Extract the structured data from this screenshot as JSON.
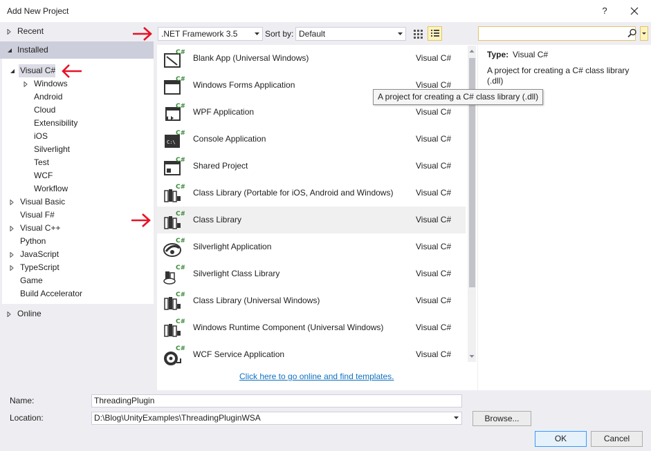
{
  "window": {
    "title": "Add New Project",
    "help_label": "?"
  },
  "tree": {
    "recent": "Recent",
    "installed": "Installed",
    "online": "Online",
    "items": [
      {
        "label": "Visual C#",
        "arrow": "expanded",
        "selected": true
      },
      {
        "label": "Windows",
        "arrow": "collapsed"
      },
      {
        "label": "Android"
      },
      {
        "label": "Cloud"
      },
      {
        "label": "Extensibility"
      },
      {
        "label": "iOS"
      },
      {
        "label": "Silverlight"
      },
      {
        "label": "Test"
      },
      {
        "label": "WCF"
      },
      {
        "label": "Workflow"
      },
      {
        "label": "Visual Basic",
        "arrow": "collapsed"
      },
      {
        "label": "Visual F#"
      },
      {
        "label": "Visual C++",
        "arrow": "collapsed"
      },
      {
        "label": "Python"
      },
      {
        "label": "JavaScript",
        "arrow": "collapsed"
      },
      {
        "label": "TypeScript",
        "arrow": "collapsed"
      },
      {
        "label": "Game"
      },
      {
        "label": "Build Accelerator"
      }
    ]
  },
  "toolbar": {
    "framework": ".NET Framework 3.5",
    "sort_label": "Sort by:",
    "sort_value": "Default",
    "search_placeholder": ""
  },
  "templates": [
    {
      "name": "Blank App (Universal Windows)",
      "lang": "Visual C#",
      "icon": "blank-app-icon"
    },
    {
      "name": "Windows Forms Application",
      "lang": "Visual C#",
      "icon": "windows-forms-icon"
    },
    {
      "name": "WPF Application",
      "lang": "Visual C#",
      "icon": "wpf-icon"
    },
    {
      "name": "Console Application",
      "lang": "Visual C#",
      "icon": "console-icon"
    },
    {
      "name": "Shared Project",
      "lang": "Visual C#",
      "icon": "shared-project-icon"
    },
    {
      "name": "Class Library (Portable for iOS, Android and Windows)",
      "lang": "Visual C#",
      "icon": "class-library-icon"
    },
    {
      "name": "Class Library",
      "lang": "Visual C#",
      "icon": "class-library-icon",
      "selected": true
    },
    {
      "name": "Silverlight Application",
      "lang": "Visual C#",
      "icon": "silverlight-icon"
    },
    {
      "name": "Silverlight Class Library",
      "lang": "Visual C#",
      "icon": "silverlight-library-icon"
    },
    {
      "name": "Class Library (Universal Windows)",
      "lang": "Visual C#",
      "icon": "class-library-icon"
    },
    {
      "name": "Windows Runtime Component (Universal Windows)",
      "lang": "Visual C#",
      "icon": "class-library-icon"
    },
    {
      "name": "WCF Service Application",
      "lang": "Visual C#",
      "icon": "wcf-icon"
    }
  ],
  "online_link": "Click here to go online and find templates.",
  "tooltip": "A project for creating a C# class library (.dll)",
  "info": {
    "type_label": "Type:",
    "type_value": "Visual C#",
    "description": "A project for creating a C# class library (.dll)"
  },
  "form": {
    "name_label": "Name:",
    "name_value": "ThreadingPlugin",
    "location_label": "Location:",
    "location_value": "D:\\Blog\\UnityExamples\\ThreadingPluginWSA",
    "browse": "Browse...",
    "ok": "OK",
    "cancel": "Cancel"
  },
  "colors": {
    "annotation_arrow": "#e81123",
    "link": "#0e70c0",
    "panel_bg": "#eeeef2",
    "selection_bg": "#dcdce6"
  }
}
